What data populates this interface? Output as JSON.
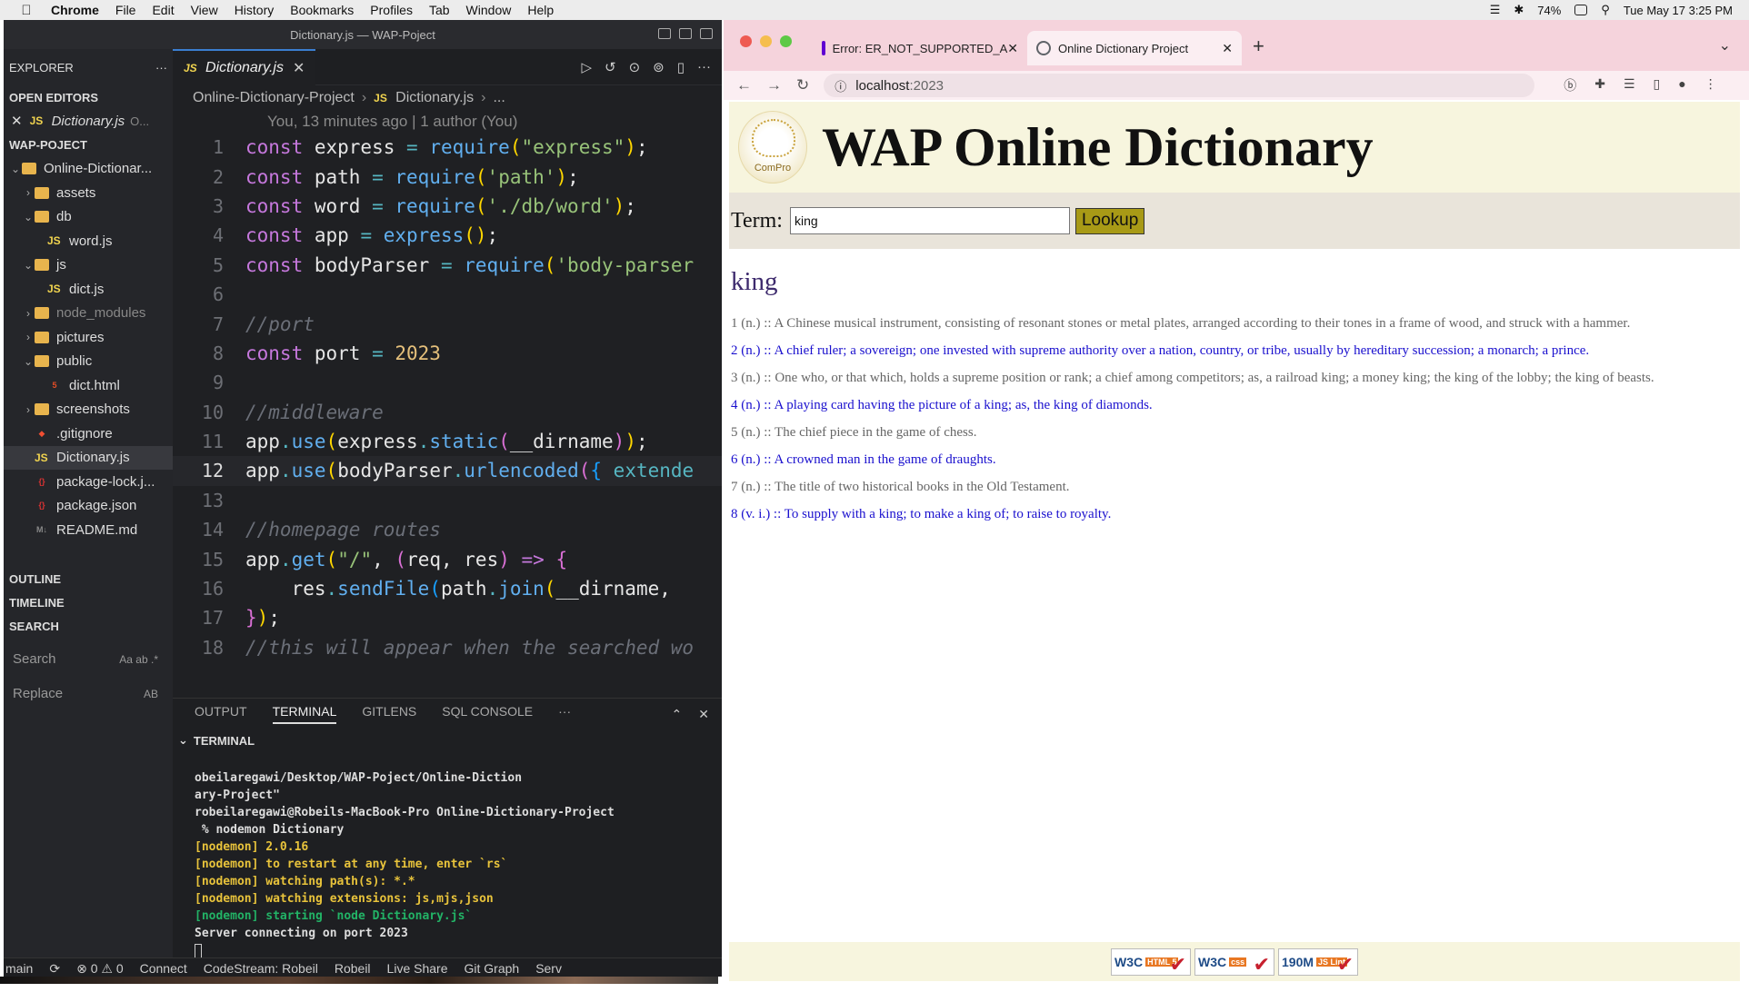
{
  "menubar": {
    "app": "Chrome",
    "items": [
      "File",
      "Edit",
      "View",
      "History",
      "Bookmarks",
      "Profiles",
      "Tab",
      "Window",
      "Help"
    ],
    "battery": "74%",
    "datetime": "Tue May 17  3:25 PM"
  },
  "vscode": {
    "window_title": "Dictionary.js — WAP-Poject",
    "explorer_label": "EXPLORER",
    "open_editors_label": "OPEN EDITORS",
    "open_editor_file": "Dictionary.js",
    "open_editor_dir": "O...",
    "project_label": "WAP-POJECT",
    "tree": [
      {
        "label": "Online-Dictionar...",
        "depth": 0,
        "kind": "folder",
        "chev": "⌄"
      },
      {
        "label": "assets",
        "depth": 1,
        "kind": "folder",
        "chev": "›"
      },
      {
        "label": "db",
        "depth": 1,
        "kind": "folder",
        "chev": "⌄"
      },
      {
        "label": "word.js",
        "depth": 2,
        "kind": "js",
        "chev": ""
      },
      {
        "label": "js",
        "depth": 1,
        "kind": "folder",
        "chev": "⌄"
      },
      {
        "label": "dict.js",
        "depth": 2,
        "kind": "js",
        "chev": ""
      },
      {
        "label": "node_modules",
        "depth": 1,
        "kind": "folder",
        "chev": "›"
      },
      {
        "label": "pictures",
        "depth": 1,
        "kind": "folder",
        "chev": "›"
      },
      {
        "label": "public",
        "depth": 1,
        "kind": "folder",
        "chev": "⌄"
      },
      {
        "label": "dict.html",
        "depth": 2,
        "kind": "html",
        "chev": ""
      },
      {
        "label": "screenshots",
        "depth": 1,
        "kind": "folder",
        "chev": "›"
      },
      {
        "label": ".gitignore",
        "depth": 1,
        "kind": "git",
        "chev": ""
      },
      {
        "label": "Dictionary.js",
        "depth": 1,
        "kind": "js",
        "chev": ""
      },
      {
        "label": "package-lock.j...",
        "depth": 1,
        "kind": "json",
        "chev": ""
      },
      {
        "label": "package.json",
        "depth": 1,
        "kind": "json",
        "chev": ""
      },
      {
        "label": "README.md",
        "depth": 1,
        "kind": "md",
        "chev": ""
      }
    ],
    "outline_label": "OUTLINE",
    "timeline_label": "TIMELINE",
    "search_label": "SEARCH",
    "search_placeholder": "Search",
    "replace_placeholder": "Replace",
    "active_tab": "Dictionary.js",
    "breadcrumb": [
      "Online-Dictionary-Project",
      "Dictionary.js",
      "..."
    ],
    "blame": "You, 13 minutes ago | 1 author (You)",
    "current_line": 12,
    "code_lines": [
      [
        [
          "k",
          "const "
        ],
        [
          "v",
          "express "
        ],
        [
          "op",
          "= "
        ],
        [
          "f",
          "require"
        ],
        [
          "p1",
          "("
        ],
        [
          "s",
          "\"express\""
        ],
        [
          "p1",
          ")"
        ],
        [
          "v",
          ";"
        ]
      ],
      [
        [
          "k",
          "const "
        ],
        [
          "v",
          "path "
        ],
        [
          "op",
          "= "
        ],
        [
          "f",
          "require"
        ],
        [
          "p1",
          "("
        ],
        [
          "s",
          "'path'"
        ],
        [
          "p1",
          ")"
        ],
        [
          "v",
          ";"
        ]
      ],
      [
        [
          "k",
          "const "
        ],
        [
          "v",
          "word "
        ],
        [
          "op",
          "= "
        ],
        [
          "f",
          "require"
        ],
        [
          "p1",
          "("
        ],
        [
          "s",
          "'./db/word'"
        ],
        [
          "p1",
          ")"
        ],
        [
          "v",
          ";"
        ]
      ],
      [
        [
          "k",
          "const "
        ],
        [
          "v",
          "app "
        ],
        [
          "op",
          "= "
        ],
        [
          "f",
          "express"
        ],
        [
          "p1",
          "()"
        ],
        [
          "v",
          ";"
        ]
      ],
      [
        [
          "k",
          "const "
        ],
        [
          "v",
          "bodyParser "
        ],
        [
          "op",
          "= "
        ],
        [
          "f",
          "require"
        ],
        [
          "p1",
          "("
        ],
        [
          "s",
          "'body-parser"
        ]
      ],
      [],
      [
        [
          "c",
          "//port"
        ]
      ],
      [
        [
          "k",
          "const "
        ],
        [
          "v",
          "port "
        ],
        [
          "op",
          "= "
        ],
        [
          "num",
          "2023"
        ]
      ],
      [],
      [
        [
          "c",
          "//middleware"
        ]
      ],
      [
        [
          "v",
          "app"
        ],
        [
          "op",
          "."
        ],
        [
          "f",
          "use"
        ],
        [
          "p1",
          "("
        ],
        [
          "v",
          "express"
        ],
        [
          "op",
          "."
        ],
        [
          "f",
          "static"
        ],
        [
          "p2",
          "("
        ],
        [
          "v",
          "__dirname"
        ],
        [
          "p2",
          ")"
        ],
        [
          "p1",
          ")"
        ],
        [
          "v",
          ";"
        ]
      ],
      [
        [
          "v",
          "app"
        ],
        [
          "op",
          "."
        ],
        [
          "f",
          "use"
        ],
        [
          "p1",
          "("
        ],
        [
          "v",
          "bodyParser"
        ],
        [
          "op",
          "."
        ],
        [
          "f",
          "urlencoded"
        ],
        [
          "p2",
          "("
        ],
        [
          "p3",
          "{ "
        ],
        [
          "op",
          "extende"
        ]
      ],
      [],
      [
        [
          "c",
          "//homepage routes"
        ]
      ],
      [
        [
          "v",
          "app"
        ],
        [
          "op",
          "."
        ],
        [
          "f",
          "get"
        ],
        [
          "p1",
          "("
        ],
        [
          "s",
          "\"/\""
        ],
        [
          "v",
          ", "
        ],
        [
          "p2",
          "("
        ],
        [
          "v",
          "req, res"
        ],
        [
          "p2",
          ")"
        ],
        [
          "k",
          " => "
        ],
        [
          "p2",
          "{"
        ]
      ],
      [
        [
          "v",
          "    res"
        ],
        [
          "op",
          "."
        ],
        [
          "f",
          "sendFile"
        ],
        [
          "p3",
          "("
        ],
        [
          "v",
          "path"
        ],
        [
          "op",
          "."
        ],
        [
          "f",
          "join"
        ],
        [
          "p1",
          "("
        ],
        [
          "v",
          "__dirname, "
        ]
      ],
      [
        [
          "p2",
          "}"
        ],
        [
          "p1",
          ")"
        ],
        [
          "v",
          ";"
        ]
      ],
      [
        [
          "c",
          "//this will appear when the searched wo"
        ]
      ]
    ],
    "panel_tabs": [
      "OUTPUT",
      "TERMINAL",
      "GITLENS",
      "SQL CONSOLE",
      "···"
    ],
    "terminal_label": "TERMINAL",
    "terminal_lines": [
      {
        "cls": "",
        "text": "obeilaregawi/Desktop/WAP-Poject/Online-Diction"
      },
      {
        "cls": "",
        "text": "ary-Project\""
      },
      {
        "cls": "",
        "text": "robeilaregawi@Robeils-MacBook-Pro Online-Dictionary-Project"
      },
      {
        "cls": "",
        "text": " % nodemon Dictionary"
      },
      {
        "cls": "y",
        "text": "[nodemon] 2.0.16"
      },
      {
        "cls": "y",
        "text": "[nodemon] to restart at any time, enter `rs`"
      },
      {
        "cls": "y",
        "text": "[nodemon] watching path(s): *.*"
      },
      {
        "cls": "y",
        "text": "[nodemon] watching extensions: js,mjs,json"
      },
      {
        "cls": "g",
        "text": "[nodemon] starting `node Dictionary.js`"
      },
      {
        "cls": "",
        "text": "Server connecting on port 2023"
      }
    ],
    "status_items": [
      "main",
      "⟳",
      "⊗ 0 ⚠ 0",
      "Connect",
      "CodeStream: Robeil",
      "Robeil",
      "Live Share",
      "Git Graph",
      "Serv"
    ]
  },
  "chrome": {
    "tabs": [
      {
        "title": "Error: ER_NOT_SUPPORTED_A",
        "favicon_color": "#6001d2",
        "active": false
      },
      {
        "title": "Online Dictionary Project",
        "favicon_color": "#5f6368",
        "active": true
      }
    ],
    "url_host": "localhost",
    "url_port": ":2023"
  },
  "page": {
    "logo_text": "ComPro",
    "title": "WAP Online Dictionary",
    "term_label": "Term:",
    "term_value": "king",
    "lookup_label": "Lookup",
    "result_word": "king",
    "definitions": [
      "1 (n.) :: A Chinese musical instrument, consisting of resonant stones or metal plates, arranged according to their tones in a frame of wood, and struck with a hammer.",
      "2 (n.) :: A chief ruler; a sovereign; one invested with supreme authority over a nation, country, or tribe, usually by hereditary succession; a monarch; a prince.",
      "3 (n.) :: One who, or that which, holds a supreme position or rank; a chief among competitors; as, a railroad king; a money king; the king of the lobby; the king of beasts.",
      "4 (n.) :: A playing card having the picture of a king; as, the king of diamonds.",
      "5 (n.) :: The chief piece in the game of chess.",
      "6 (n.) :: A crowned man in the game of draughts.",
      "7 (n.) :: The title of two historical books in the Old Testament.",
      "8 (v. i.) :: To supply with a king; to make a king of; to raise to royalty."
    ],
    "badges": [
      {
        "main": "W3C",
        "sub": "HTML 5"
      },
      {
        "main": "W3C",
        "sub": "css"
      },
      {
        "main": "190M",
        "sub": "JS Lint"
      }
    ]
  },
  "colors": {
    "link": "#1a10ce",
    "visited": "#666666",
    "header_bg": "#f7f5de",
    "lookup_bg": "#a89a16"
  }
}
